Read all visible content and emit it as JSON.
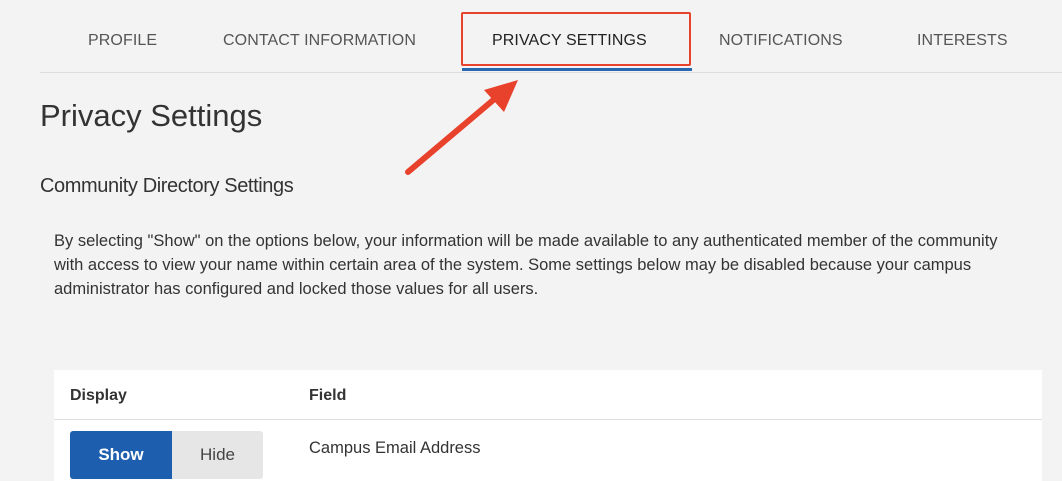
{
  "tabs": {
    "profile": "PROFILE",
    "contact": "CONTACT INFORMATION",
    "privacy": "PRIVACY SETTINGS",
    "notifications": "NOTIFICATIONS",
    "interests": "INTERESTS",
    "active": "PRIVACY SETTINGS"
  },
  "page": {
    "title": "Privacy Settings",
    "section_title": "Community Directory Settings",
    "description": "By selecting \"Show\" on the options below, your information will be made available to any authenticated member of the community with access to view your name within certain area of the system. Some settings below may be disabled because your campus administrator has configured and locked those values for all users."
  },
  "table": {
    "headers": {
      "display": "Display",
      "field": "Field"
    },
    "rows": [
      {
        "show_label": "Show",
        "hide_label": "Hide",
        "selected": "Show",
        "field": "Campus Email Address"
      }
    ]
  },
  "colors": {
    "accent": "#2a67b1",
    "show_button": "#1d5fae",
    "annotation": "#e8412c",
    "background": "#f3f3f3"
  }
}
